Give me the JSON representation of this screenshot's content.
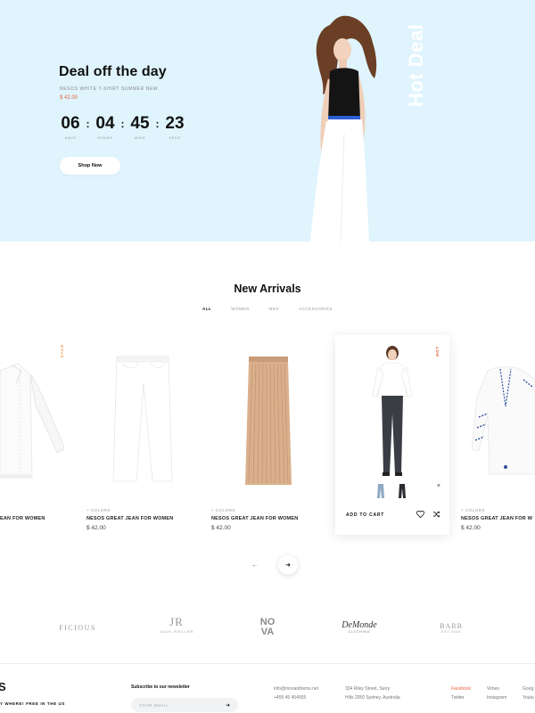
{
  "hero": {
    "title": "Deal off the day",
    "subtitle": "NESOS WHITE T-SHIRT SUMMER NEW",
    "price": "$ 42.00",
    "countdown": [
      {
        "value": "06",
        "label": "DAYS"
      },
      {
        "value": "04",
        "label": "HOURS"
      },
      {
        "value": "45",
        "label": "MINS"
      },
      {
        "value": "23",
        "label": "SECS"
      }
    ],
    "separator": ":",
    "cta": "Shop Now",
    "side_text": "Hot Deal",
    "bg_color": "#dff4fd"
  },
  "arrivals": {
    "title": "New Arrivals",
    "filters": [
      "ALL",
      "WOMEN",
      "MEN",
      "ACCESSORIES"
    ],
    "active_filter": "ALL",
    "products": [
      {
        "name": "EAN FOR WOMEN",
        "badge": "SALE",
        "image": "white-shirt"
      },
      {
        "colors": "+ COLORS",
        "name": "NESOS GREAT JEAN FOR WOMEN",
        "price": "$ 42.00",
        "image": "white-jeans"
      },
      {
        "colors": "+ COLORS",
        "name": "NESOS GREAT JEAN FOR WOMEN",
        "price": "$ 42.00",
        "image": "pleated-skirt"
      },
      {
        "badge": "HOT",
        "add_to_cart": "ADD TO CART",
        "image": "model-jeans",
        "close": "×"
      },
      {
        "colors": "+ COLORS",
        "name": "NESOS GREAT JEAN FOR W",
        "price": "$ 42.00",
        "image": "embroidered-blouse"
      }
    ],
    "prev_icon": "arrow-left-icon",
    "next_icon": "arrow-right-icon"
  },
  "brands": [
    {
      "name": "FICIOUS"
    },
    {
      "name": "JR",
      "sub": "JACK ROLLER"
    },
    {
      "name": "NO VA"
    },
    {
      "name": "DeMonde",
      "sub": "CLOTHING"
    },
    {
      "name": "BARB",
      "sub": "EST 2016"
    }
  ],
  "footer": {
    "logo": "S",
    "tagline": "Y WHERE! FREE IN THE US",
    "newsletter_title": "Subscribe to our newsletter",
    "email_placeholder": "YOUR EMAIL",
    "contact": [
      "info@mosanthems.net",
      "+455 45 454555"
    ],
    "address": [
      "334 Riley Street, Surry",
      "Hills 2050 Sydney, Australia"
    ],
    "social_col1": [
      "Facebook",
      "Twitter"
    ],
    "social_col2": [
      "Vimeo",
      "Instagram"
    ],
    "social_col3": [
      "Goog",
      "Youtu"
    ],
    "accent_color": "#e8643a"
  }
}
